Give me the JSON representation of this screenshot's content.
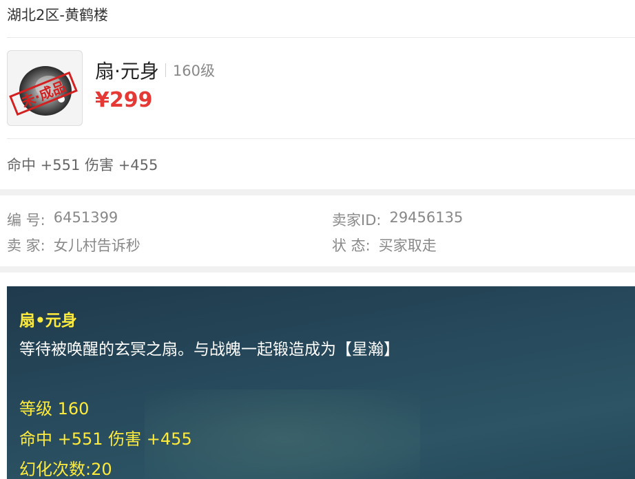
{
  "header": {
    "server": "湖北2区-黄鹤楼"
  },
  "item": {
    "name": "扇·元身",
    "level": "160级",
    "price": "¥299",
    "stamp_text": "未·成品",
    "stats": "命中 +551 伤害 +455"
  },
  "info": {
    "id_label": "编 号:",
    "id_value": "6451399",
    "seller_id_label": "卖家ID:",
    "seller_id_value": "29456135",
    "seller_label": "卖 家:",
    "seller_value": "女儿村告诉秒",
    "status_label": "状 态:",
    "status_value": "买家取走"
  },
  "detail": {
    "title": "扇•元身",
    "description": "等待被唤醒的玄冥之扇。与战魄一起锻造成为【星瀚】",
    "level_line": "等级 160",
    "stats_line": "命中 +551 伤害 +455",
    "transform_line": "幻化次数:20"
  },
  "colors": {
    "price": "#e53935",
    "panel_bg": "#254658",
    "highlight": "#ffeb3b"
  }
}
